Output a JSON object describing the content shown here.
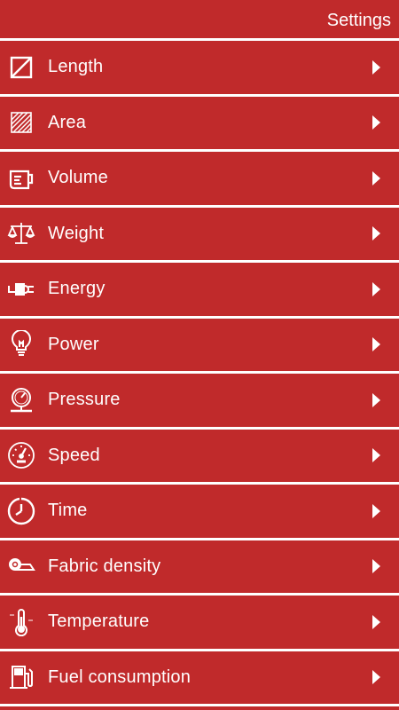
{
  "header": {
    "settings_label": "Settings"
  },
  "theme": {
    "background": "#c02a2b",
    "foreground": "#ffffff"
  },
  "items": [
    {
      "label": "Length",
      "icon": "ruler-square-icon"
    },
    {
      "label": "Area",
      "icon": "hatched-square-icon"
    },
    {
      "label": "Volume",
      "icon": "measuring-cup-icon"
    },
    {
      "label": "Weight",
      "icon": "balance-scale-icon"
    },
    {
      "label": "Energy",
      "icon": "plug-icon"
    },
    {
      "label": "Power",
      "icon": "lightbulb-icon"
    },
    {
      "label": "Pressure",
      "icon": "pressure-gauge-icon"
    },
    {
      "label": "Speed",
      "icon": "speedometer-icon"
    },
    {
      "label": "Time",
      "icon": "clock-icon"
    },
    {
      "label": "Fabric density",
      "icon": "fabric-roll-icon"
    },
    {
      "label": "Temperature",
      "icon": "thermometer-icon"
    },
    {
      "label": "Fuel consumption",
      "icon": "fuel-pump-icon"
    }
  ]
}
